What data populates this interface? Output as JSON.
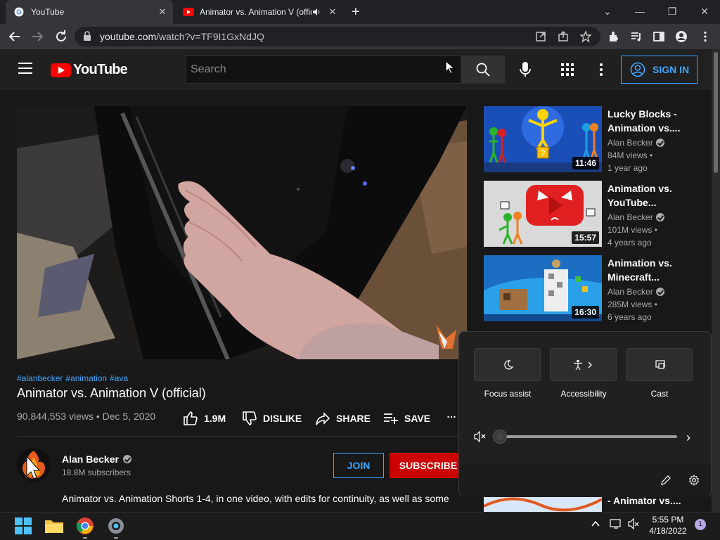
{
  "browser": {
    "tabs": [
      {
        "title": "YouTube",
        "active": true
      },
      {
        "title": "Animator vs. Animation V (offici",
        "active": false
      }
    ],
    "url_host": "youtube.com",
    "url_path": "/watch?v=TF9I1GxNdJQ"
  },
  "masthead": {
    "logo_text": "YouTube",
    "search_placeholder": "Search",
    "signin_label": "SIGN IN"
  },
  "video": {
    "hashtags": [
      "#alanbecker",
      "#animation",
      "#ava"
    ],
    "title": "Animator vs. Animation V (official)",
    "meta": "90,844,553 views • Dec 5, 2020",
    "actions": {
      "like": "1.9M",
      "dislike": "DISLIKE",
      "share": "SHARE",
      "save": "SAVE",
      "more": "…"
    }
  },
  "channel": {
    "name": "Alan Becker",
    "subscribers": "18.8M subscribers",
    "join_label": "JOIN",
    "subscribe_label": "SUBSCRIBE",
    "description": "Animator vs. Animation Shorts 1-4, in one video, with edits for continuity, as well as some"
  },
  "recommendations": [
    {
      "title": "Lucky Blocks - Animation vs....",
      "channel": "Alan Becker",
      "views": "84M views •",
      "age": "1 year ago",
      "duration": "11:46"
    },
    {
      "title": "Animation vs. YouTube...",
      "channel": "Alan Becker",
      "views": "101M views •",
      "age": "4 years ago",
      "duration": "15:57"
    },
    {
      "title": "Animation vs. Minecraft...",
      "channel": "Alan Becker",
      "views": "285M views •",
      "age": "6 years ago",
      "duration": "16:30"
    },
    {
      "title": "- Animator vs...."
    }
  ],
  "quick_settings": {
    "tiles": [
      "Focus assist",
      "Accessibility",
      "Cast"
    ],
    "volume_level": 0
  },
  "taskbar": {
    "time": "5:55 PM",
    "date": "4/18/2022",
    "notifications": "1"
  },
  "colors": {
    "accent_blue": "#3ea6ff",
    "subscribe_red": "#cc0000",
    "youtube_red": "#ff0000"
  }
}
